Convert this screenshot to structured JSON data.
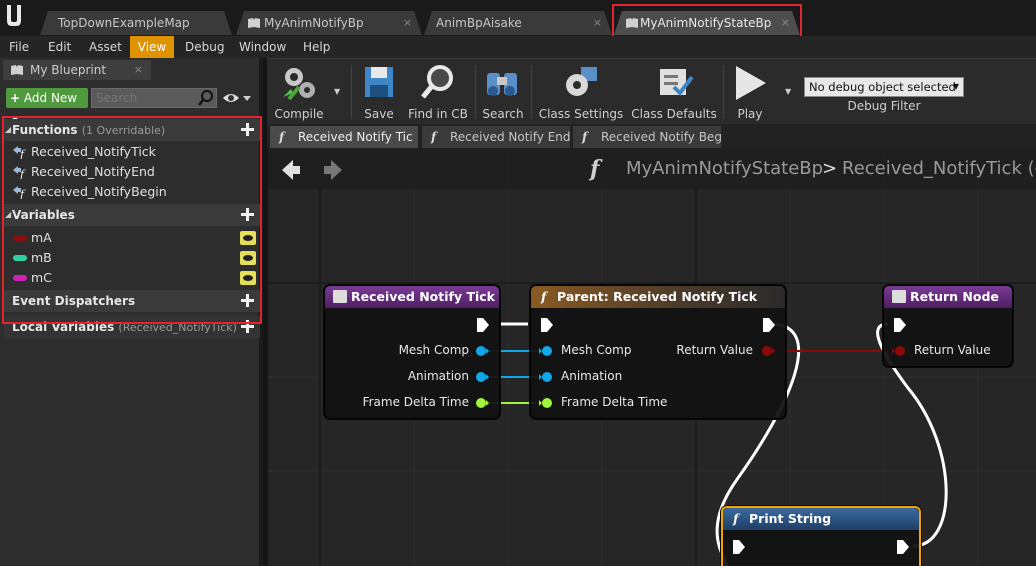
{
  "document_tabs": [
    {
      "label": "TopDownExampleMap"
    },
    {
      "label": "MyAnimNotifyBp",
      "close": "×"
    },
    {
      "label": "AnimBpAisake",
      "close": "×"
    },
    {
      "label": "MyAnimNotifyStateBp",
      "close": "×"
    }
  ],
  "menu": [
    "File",
    "Edit",
    "Asset",
    "View",
    "Debug",
    "Window",
    "Help"
  ],
  "menu_active": "View",
  "my_blueprint": {
    "tab_label": "My Blueprint",
    "tab_close": "×",
    "add_new": "Add New",
    "search_placeholder": "Search",
    "functions_header": "Functions",
    "functions_sub": "(1 Overridable)",
    "functions": [
      "Received_NotifyTick",
      "Received_NotifyEnd",
      "Received_NotifyBegin"
    ],
    "variables_header": "Variables",
    "variables": [
      {
        "name": "mA",
        "color": "#8a0c0c"
      },
      {
        "name": "mB",
        "color": "#2fcfa4"
      },
      {
        "name": "mC",
        "color": "#d020b8"
      }
    ],
    "event_dispatchers_header": "Event Dispatchers",
    "local_variables_header": "Local Variables",
    "local_variables_sub": "(Received_NotifyTick)"
  },
  "toolbar": {
    "compile": "Compile",
    "save": "Save",
    "find_in_cb": "Find in CB",
    "search": "Search",
    "class_settings": "Class Settings",
    "class_defaults": "Class Defaults",
    "play": "Play",
    "debug_select": "No debug object selected",
    "debug_filter": "Debug Filter"
  },
  "graph_tabs": [
    "Received Notify Tic",
    "Received Notify End",
    "Received Notify Beg"
  ],
  "breadcrumb": {
    "blueprint": "MyAnimNotifyStateBp",
    "separator": ">",
    "function": "Received_NotifyTick (c"
  },
  "nodes": {
    "entry": {
      "title": "Received Notify Tick",
      "outputs": [
        "Mesh Comp",
        "Animation",
        "Frame Delta Time"
      ]
    },
    "parent": {
      "title": "Parent: Received Notify Tick",
      "inputs": [
        "Mesh Comp",
        "Animation",
        "Frame Delta Time"
      ],
      "outputs": [
        "Return Value"
      ]
    },
    "return": {
      "title": "Return Node",
      "inputs": [
        "Return Value"
      ]
    },
    "print": {
      "title": "Print String"
    }
  },
  "colors": {
    "accent_highlight": "#e0252e",
    "menu_active": "#e09300",
    "add_new": "#4f9a3c",
    "pin_object": "#11a7e8",
    "pin_float": "#9ff53a",
    "pin_bool": "#8a0a0a",
    "entry_header": "#6a2a83",
    "parent_header": "#7a4a1a",
    "print_header": "#2d5c8e"
  }
}
